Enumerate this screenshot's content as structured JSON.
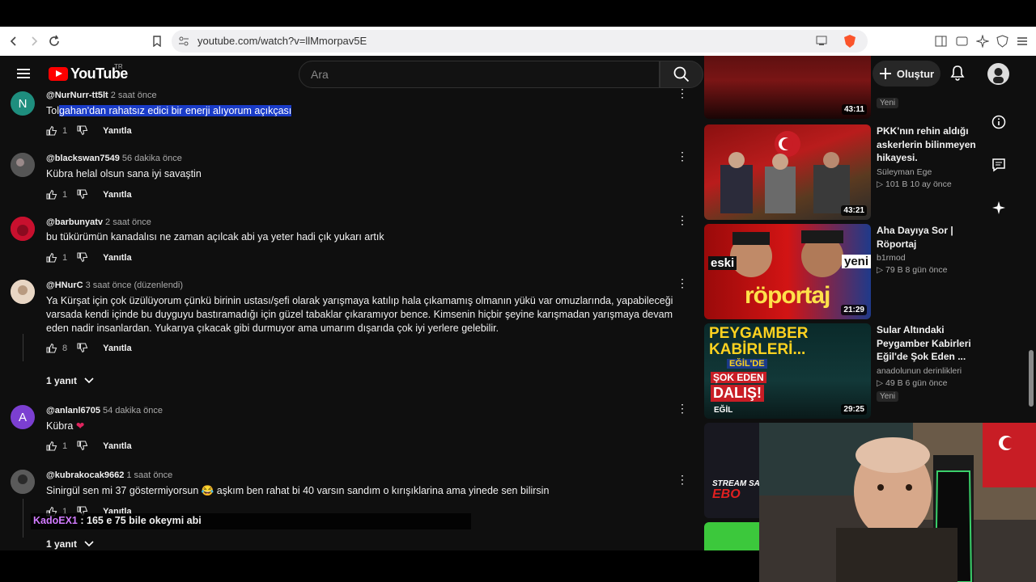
{
  "browser": {
    "url": "youtube.com/watch?v=llMmorpav5E"
  },
  "masthead": {
    "logo_text": "YouTube",
    "logo_region": "TR",
    "search_placeholder": "Ara",
    "create_label": "Oluştur"
  },
  "comments": [
    {
      "avatar_letter": "N",
      "avatar_color": "#1e8e7e",
      "handle": "@NurNurr-tt5lt",
      "time": "2 saat önce",
      "text_plain": "Tol",
      "text_highlight": "gahan'dan rahatsız edici bir enerji alıyorum açıkçası",
      "likes": "1",
      "reply_label": "Yanıtla"
    },
    {
      "handle": "@blackswan7549",
      "time": "56 dakika önce",
      "text": "Kübra helal olsun sana iyi savaştin",
      "likes": "1",
      "reply_label": "Yanıtla"
    },
    {
      "handle": "@barbunyatv",
      "time": "2 saat önce",
      "text": "bu tükürümün kanadalısı ne zaman açılcak abi ya yeter hadi çık yukarı artık",
      "likes": "1",
      "reply_label": "Yanıtla"
    },
    {
      "handle": "@HNurC",
      "time": "3 saat önce (düzenlendi)",
      "text": "Ya Kürşat için çok üzülüyorum çünkü birinin ustası/şefi olarak yarışmaya katılıp hala çıkamamış olmanın yükü var omuzlarında, yapabileceği varsada kendi içinde bu duyguyu bastıramadığı için güzel tabaklar çıkaramıyor bence. Kimsenin hiçbir şeyine karışmadan yarışmaya devam eden nadir insanlardan. Yukarıya çıkacak gibi durmuyor ama umarım dışarıda çok iyi yerlere gelebilir.",
      "likes": "8",
      "reply_label": "Yanıtla",
      "replies_label": "1 yanıt"
    },
    {
      "avatar_letter": "A",
      "avatar_color": "#7b3fd1",
      "handle": "@anlanl6705",
      "time": "54 dakika önce",
      "text": "Kübra",
      "likes": "1",
      "reply_label": "Yanıtla"
    },
    {
      "handle": "@kubrakocak9662",
      "time": "1 saat önce",
      "text": "Sinirgül sen mi 37 göstermiyorsun 😂  aşkım ben rahat bi 40 varsın sandım  o kırışıklarina ama yinede sen bilirsin",
      "likes": "1",
      "reply_label": "Yanıtla",
      "replies_label": "1 yanıt"
    }
  ],
  "chat_overlay": {
    "name": "KadoEX1",
    "message": " : 165 e 75 bile okeymi abi"
  },
  "rail": [
    {
      "duration": "43:11",
      "badge": "Yeni"
    },
    {
      "title": "PKK'nın rehin aldığı askerlerin bilinmeyen hikayesi.",
      "channel": "Süleyman Ege",
      "stats": "101 B   10 ay önce",
      "duration": "43:21"
    },
    {
      "title": "Aha Dayıya Sor | Röportaj",
      "channel": "b1rmod",
      "stats": "79 B   8 gün önce",
      "duration": "21:29",
      "thumb_text_left": "eski",
      "thumb_text_right": "yeni",
      "thumb_text_main": "röportaj"
    },
    {
      "title": "Sular Altındaki Peygamber Kabirleri Eğil'de Şok Eden ...",
      "channel": "anadolunun derinlikleri",
      "stats": "49 B   6 gün önce",
      "badge": "Yeni",
      "duration": "29:25",
      "thumb_line1": "PEYGAMBER",
      "thumb_line2": "KABİRLERİ...",
      "thumb_line3": "EĞİL'DE",
      "thumb_line4": "ŞOK EDEN",
      "thumb_line5": "DALIŞ!",
      "thumb_line6": "EĞİL"
    },
    {
      "thumb_text": "STREAM SAV",
      "thumb_text2": "EBO"
    }
  ]
}
